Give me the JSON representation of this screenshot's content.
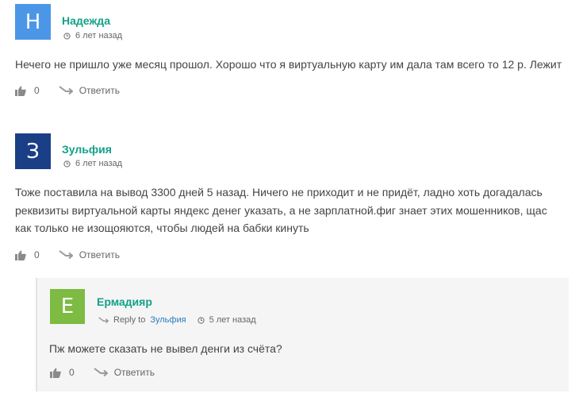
{
  "comments": [
    {
      "author": "Надежда",
      "avatar_letter": "Н",
      "avatar_color": "#4c96e8",
      "time": "6 лет назад",
      "text": "Нечего не пришло уже месяц прошол. Хорошо что я виртуальную карту им дала там всего то 12 р. Лежит",
      "likes": "0",
      "reply_label": "Ответить"
    },
    {
      "author": "Зульфия",
      "avatar_letter": "З",
      "avatar_color": "#1b3f86",
      "time": "6 лет назад",
      "text": "Тоже поставила на вывод 3300 дней 5 назад. Ничего не приходит и не придёт, ладно хоть догадалась\nреквизиты виртуальной карты яндекс денег указать, а не зарплатной.фиг знает этих мошенников, щас\nкак только не изощояются, чтобы людей на бабки кинуть",
      "likes": "0",
      "reply_label": "Ответить"
    }
  ],
  "reply": {
    "author": "Ермадияр",
    "avatar_letter": "Е",
    "avatar_color": "#7dbb42",
    "reply_to_prefix": "Reply to",
    "reply_to_name": "Зульфия",
    "time": "5 лет назад",
    "text": "Пж можете сказать не вывел денги из счёта?",
    "likes": "0",
    "reply_label": "Ответить"
  }
}
